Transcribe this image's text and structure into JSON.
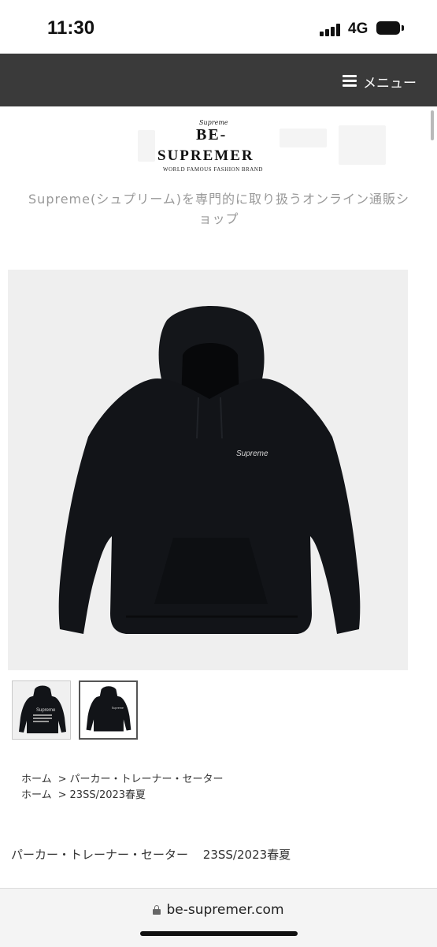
{
  "status_bar": {
    "time": "11:30",
    "network": "4G"
  },
  "header": {
    "menu_label": "メニュー"
  },
  "logo": {
    "small_text": "Supreme",
    "line1": "BE-",
    "line2": "SUPREMER",
    "tagline": "WORLD FAMOUS FASHION BRAND"
  },
  "site_description": "Supreme(シュプリーム)を専門的に取り扱うオンライン通販ショップ",
  "product": {
    "image_name": "black-hoodie",
    "chest_logo": "Supreme",
    "thumbnails": [
      {
        "name": "hoodie-back",
        "label": "Supreme",
        "selected": false
      },
      {
        "name": "hoodie-front",
        "label": "Supreme",
        "selected": true
      }
    ]
  },
  "breadcrumbs": [
    {
      "home": "ホーム",
      "category": "パーカー・トレーナー・セーター"
    },
    {
      "home": "ホーム",
      "category": "23SS/2023春夏"
    }
  ],
  "categories": [
    "パーカー・トレーナー・セーター",
    "23SS/2023春夏"
  ],
  "browser": {
    "url": "be-supremer.com"
  },
  "colors": {
    "navbar": "#3a3a3a",
    "garment": "#121418",
    "background": "#efefef"
  }
}
